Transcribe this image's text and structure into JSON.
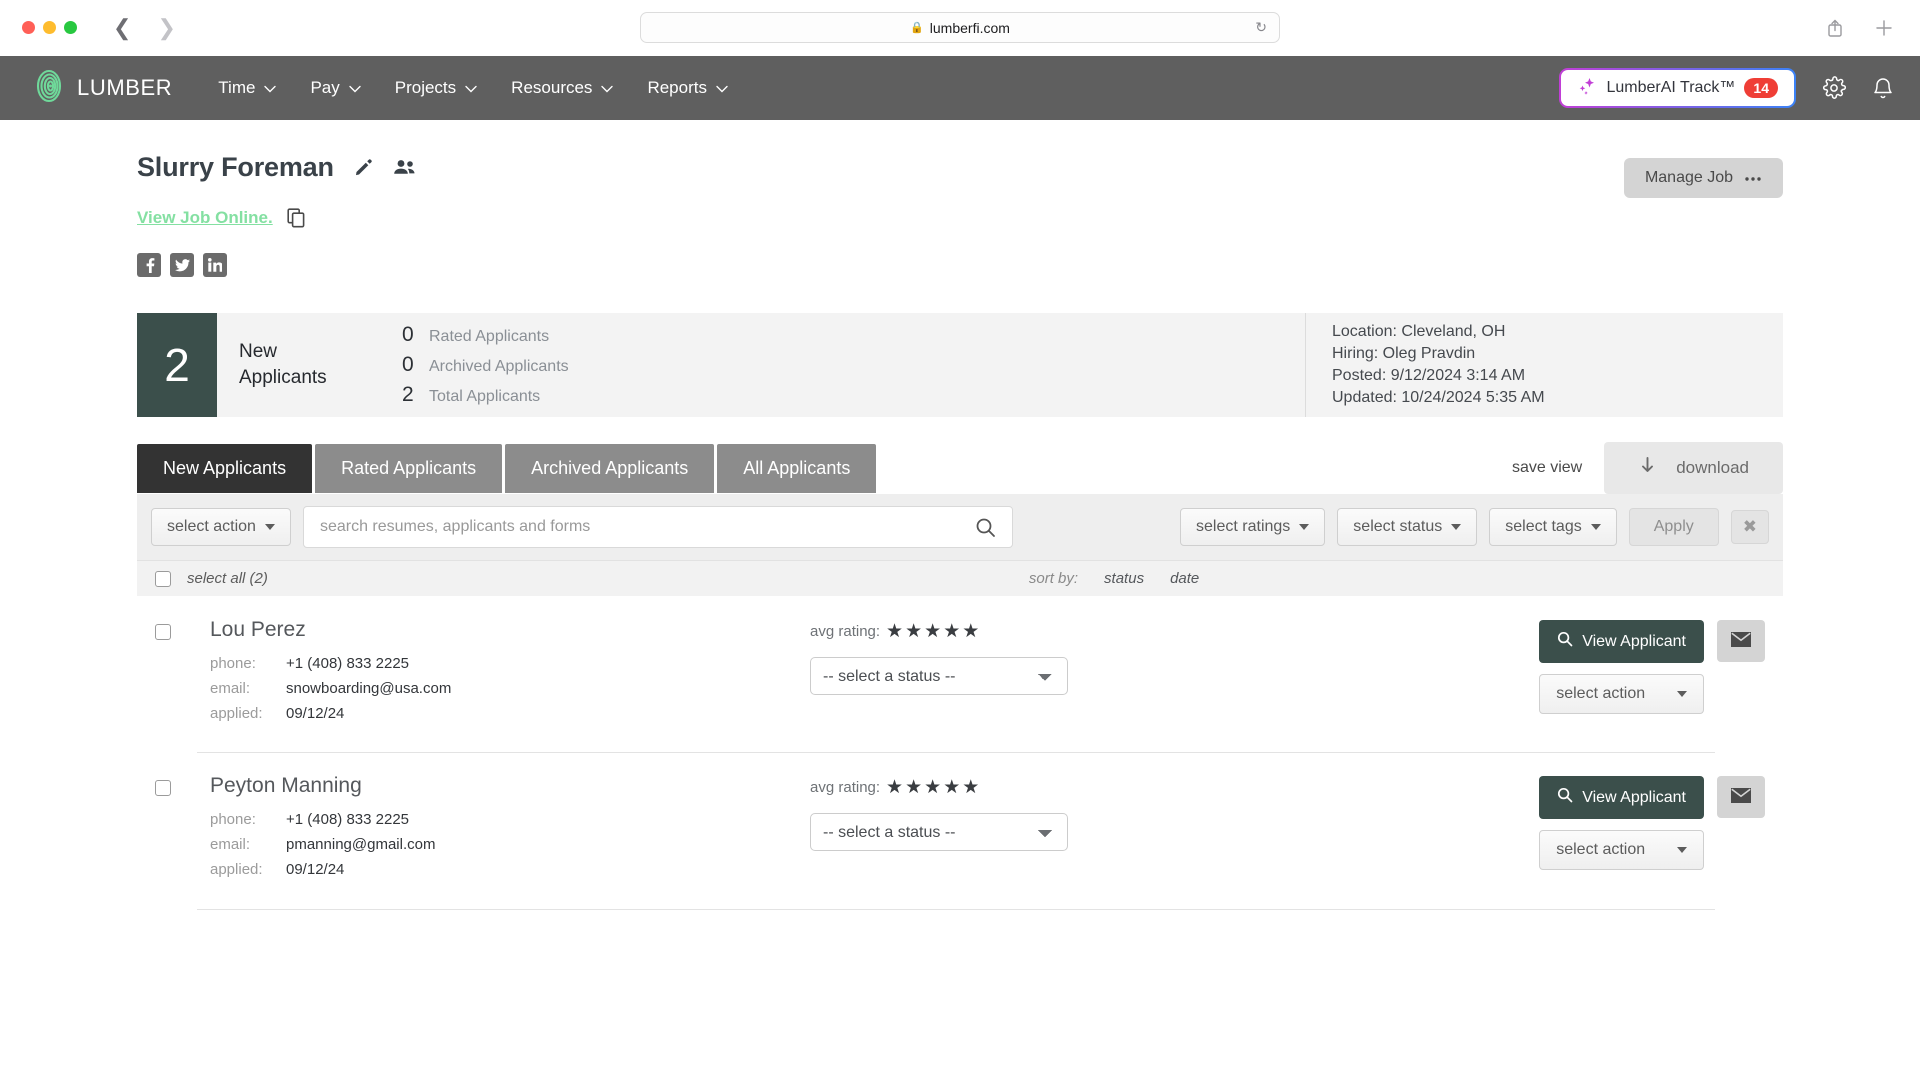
{
  "browser": {
    "url": "lumberfi.com",
    "lock_icon": "lock-icon",
    "reload_icon": "reload-icon",
    "back_icon": "back-arrow-icon",
    "forward_icon": "forward-arrow-icon",
    "share_icon": "share-icon",
    "new_tab_icon": "plus-icon"
  },
  "topnav": {
    "brand": "LUMBER",
    "logo_icon": "lumber-spiral-logo",
    "brand_color": "#6fd99a",
    "bg_color": "#5f5f5f",
    "items": [
      {
        "label": "Time"
      },
      {
        "label": "Pay"
      },
      {
        "label": "Projects"
      },
      {
        "label": "Resources"
      },
      {
        "label": "Reports"
      }
    ],
    "ai_button": {
      "label": "LumberAI Track™",
      "badge": "14",
      "badge_color": "#ef3e36",
      "sparkle_icon": "sparkles-icon"
    },
    "settings_icon": "gear-icon",
    "notifications_icon": "bell-icon"
  },
  "job": {
    "title": "Slurry Foreman",
    "edit_icon": "pencil-icon",
    "team_icon": "people-icon",
    "view_online_label": "View Job Online.",
    "view_online_color": "#84e0a2",
    "copy_icon": "copy-icon",
    "manage_button": "Manage Job",
    "manage_more_icon": "ellipsis-icon",
    "socials": [
      {
        "name": "facebook-icon"
      },
      {
        "name": "twitter-icon"
      },
      {
        "name": "linkedin-icon"
      }
    ]
  },
  "stats": {
    "new_count": "2",
    "new_label_line1": "New",
    "new_label_line2": "Applicants",
    "accent_color": "#3b4f4b",
    "counts": [
      {
        "num": "0",
        "text": "Rated Applicants"
      },
      {
        "num": "0",
        "text": "Archived Applicants"
      },
      {
        "num": "2",
        "text": "Total Applicants"
      }
    ],
    "meta": [
      "Location: Cleveland, OH",
      "Hiring: Oleg Pravdin",
      "Posted: 9/12/2024 3:14 AM",
      "Updated: 10/24/2024 5:35 AM"
    ]
  },
  "tabs": [
    {
      "label": "New Applicants",
      "active": true
    },
    {
      "label": "Rated Applicants",
      "active": false
    },
    {
      "label": "Archived Applicants",
      "active": false
    },
    {
      "label": "All Applicants",
      "active": false
    }
  ],
  "tabs_right": {
    "save_view": "save view",
    "download": "download",
    "download_icon": "download-arrow-icon"
  },
  "toolbar": {
    "select_action": "select action",
    "search_placeholder": "search resumes, applicants and forms",
    "search_value": "",
    "search_icon": "search-icon",
    "select_ratings": "select ratings",
    "select_status": "select status",
    "select_tags": "select tags",
    "apply": "Apply",
    "clear_icon": "close-x-icon"
  },
  "list_header": {
    "select_all": "select all (2)",
    "sort_by": "sort by:",
    "sort_status": "status",
    "sort_date": "date"
  },
  "labels": {
    "phone": "phone:",
    "email": "email:",
    "applied": "applied:",
    "avg_rating": "avg rating:",
    "status_placeholder": "-- select a status --",
    "view_applicant": "View Applicant",
    "view_icon": "magnifier-icon",
    "select_action": "select action",
    "mail_icon": "envelope-icon",
    "star": "★"
  },
  "applicants": [
    {
      "name": "Lou Perez",
      "phone": "+1 (408) 833 2225",
      "email": "snowboarding@usa.com",
      "applied": "09/12/24",
      "stars": 5,
      "status": "-- select a status --"
    },
    {
      "name": "Peyton Manning",
      "phone": "+1 (408) 833 2225",
      "email": "pmanning@gmail.com",
      "applied": "09/12/24",
      "stars": 5,
      "status": "-- select a status --"
    }
  ]
}
